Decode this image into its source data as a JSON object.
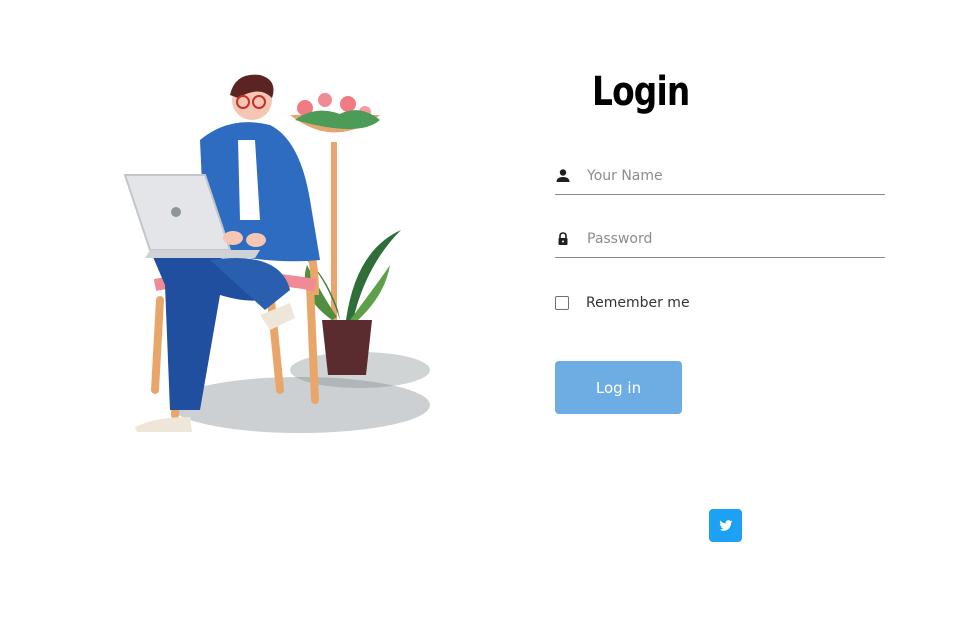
{
  "login": {
    "title": "Login",
    "name_field": {
      "placeholder": "Your Name",
      "value": ""
    },
    "password_field": {
      "placeholder": "Password",
      "value": ""
    },
    "remember_label": "Remember me",
    "remember_checked": false,
    "submit_label": "Log in"
  },
  "social": {
    "twitter_icon": "twitter-icon",
    "twitter_color": "#1da1f2"
  },
  "colors": {
    "button": "#6dade3",
    "underline": "#8a8a8a"
  }
}
